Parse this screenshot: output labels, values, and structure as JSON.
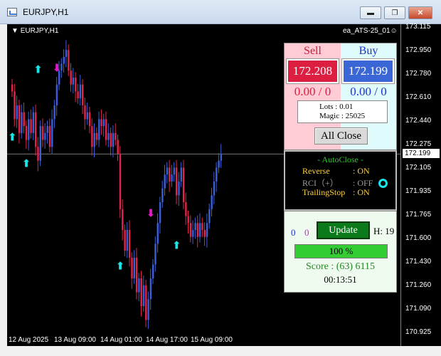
{
  "window": {
    "title": "EURJPY,H1",
    "minimize": "▬",
    "restore": "❐",
    "close": "✕"
  },
  "chart": {
    "symbol_label": "EURJPY,H1",
    "ea_label": "ea_ATS-25_01☺",
    "current_price": "172.199",
    "bull_color": "#3a5fd9",
    "bear_color": "#e0264a",
    "line_color": "#c0c0c0"
  },
  "chart_data": {
    "type": "candlestick",
    "y_ticks": [
      "173.115",
      "172.950",
      "172.780",
      "172.610",
      "172.440",
      "172.275",
      "172.105",
      "171.935",
      "171.765",
      "171.600",
      "171.430",
      "171.260",
      "171.090",
      "170.925"
    ],
    "ylim": [
      170.925,
      173.115
    ],
    "x_tick_labels": [
      "12 Aug 2025",
      "13 Aug 09:00",
      "14 Aug 01:00",
      "14 Aug 17:00",
      "15 Aug 09:00"
    ],
    "current_price": 172.199,
    "closes": [
      172.65,
      172.45,
      172.55,
      172.35,
      172.5,
      172.4,
      172.3,
      172.45,
      172.35,
      172.5,
      172.25,
      172.15,
      172.4,
      172.3,
      172.35,
      172.4,
      172.25,
      172.45,
      172.55,
      172.7,
      172.8,
      172.85,
      172.9,
      172.95,
      172.8,
      172.7,
      172.75,
      172.65,
      172.6,
      172.7,
      172.55,
      172.45,
      172.5,
      172.4,
      172.25,
      172.35,
      172.3,
      172.45,
      172.4,
      172.45,
      172.3,
      172.35,
      172.25,
      172.35,
      172.3,
      172.2,
      171.8,
      171.65,
      171.5,
      171.65,
      171.45,
      171.3,
      171.45,
      171.2,
      171.3,
      171.1,
      171.25,
      171.0,
      171.15,
      171.3,
      171.4,
      171.55,
      171.7,
      171.85,
      171.95,
      172.05,
      172.1,
      172.0,
      172.05,
      172.1,
      171.9,
      172.0,
      172.1,
      171.85,
      171.75,
      171.7,
      171.6,
      171.65,
      171.7,
      171.6,
      171.7,
      171.65,
      171.6,
      171.7,
      171.8,
      171.9,
      172.0,
      172.1,
      172.15,
      172.2
    ],
    "signals": [
      {
        "type": "buy",
        "index": 0,
        "price": 172.32
      },
      {
        "type": "buy",
        "index": 6,
        "price": 172.13
      },
      {
        "type": "buy",
        "index": 11,
        "price": 172.81
      },
      {
        "type": "sell",
        "index": 19,
        "price": 172.82
      },
      {
        "type": "buy",
        "index": 46,
        "price": 171.39
      },
      {
        "type": "sell",
        "index": 59,
        "price": 171.77
      },
      {
        "type": "buy",
        "index": 70,
        "price": 171.54
      }
    ]
  },
  "trade_panel": {
    "sell_title": "Sell",
    "buy_title": "Buy",
    "sell_price": "172.208",
    "buy_price": "172.199",
    "sell_pl": "0.00 / 0",
    "buy_pl": "0.00 / 0",
    "lots": "Lots : 0.01",
    "magic": "Magic : 25025",
    "all_close": "All Close"
  },
  "auto_close": {
    "title": "- AutoClose -",
    "rows": [
      {
        "key": "Reverse",
        "value": ": ON",
        "color": "#ffd23d"
      },
      {
        "key": "RCI（+）",
        "value": ": OFF",
        "color": "#9a9a9a"
      },
      {
        "key": "TrailingStop",
        "value": ": ON",
        "color": "#ffd23d"
      }
    ]
  },
  "score_panel": {
    "count_a": "0",
    "count_b": "0",
    "update": "Update",
    "hours": "H: 19",
    "progress": "100 %",
    "progress_value": 100,
    "score": "Score : (63) 6115",
    "timer": "00:13:51"
  }
}
